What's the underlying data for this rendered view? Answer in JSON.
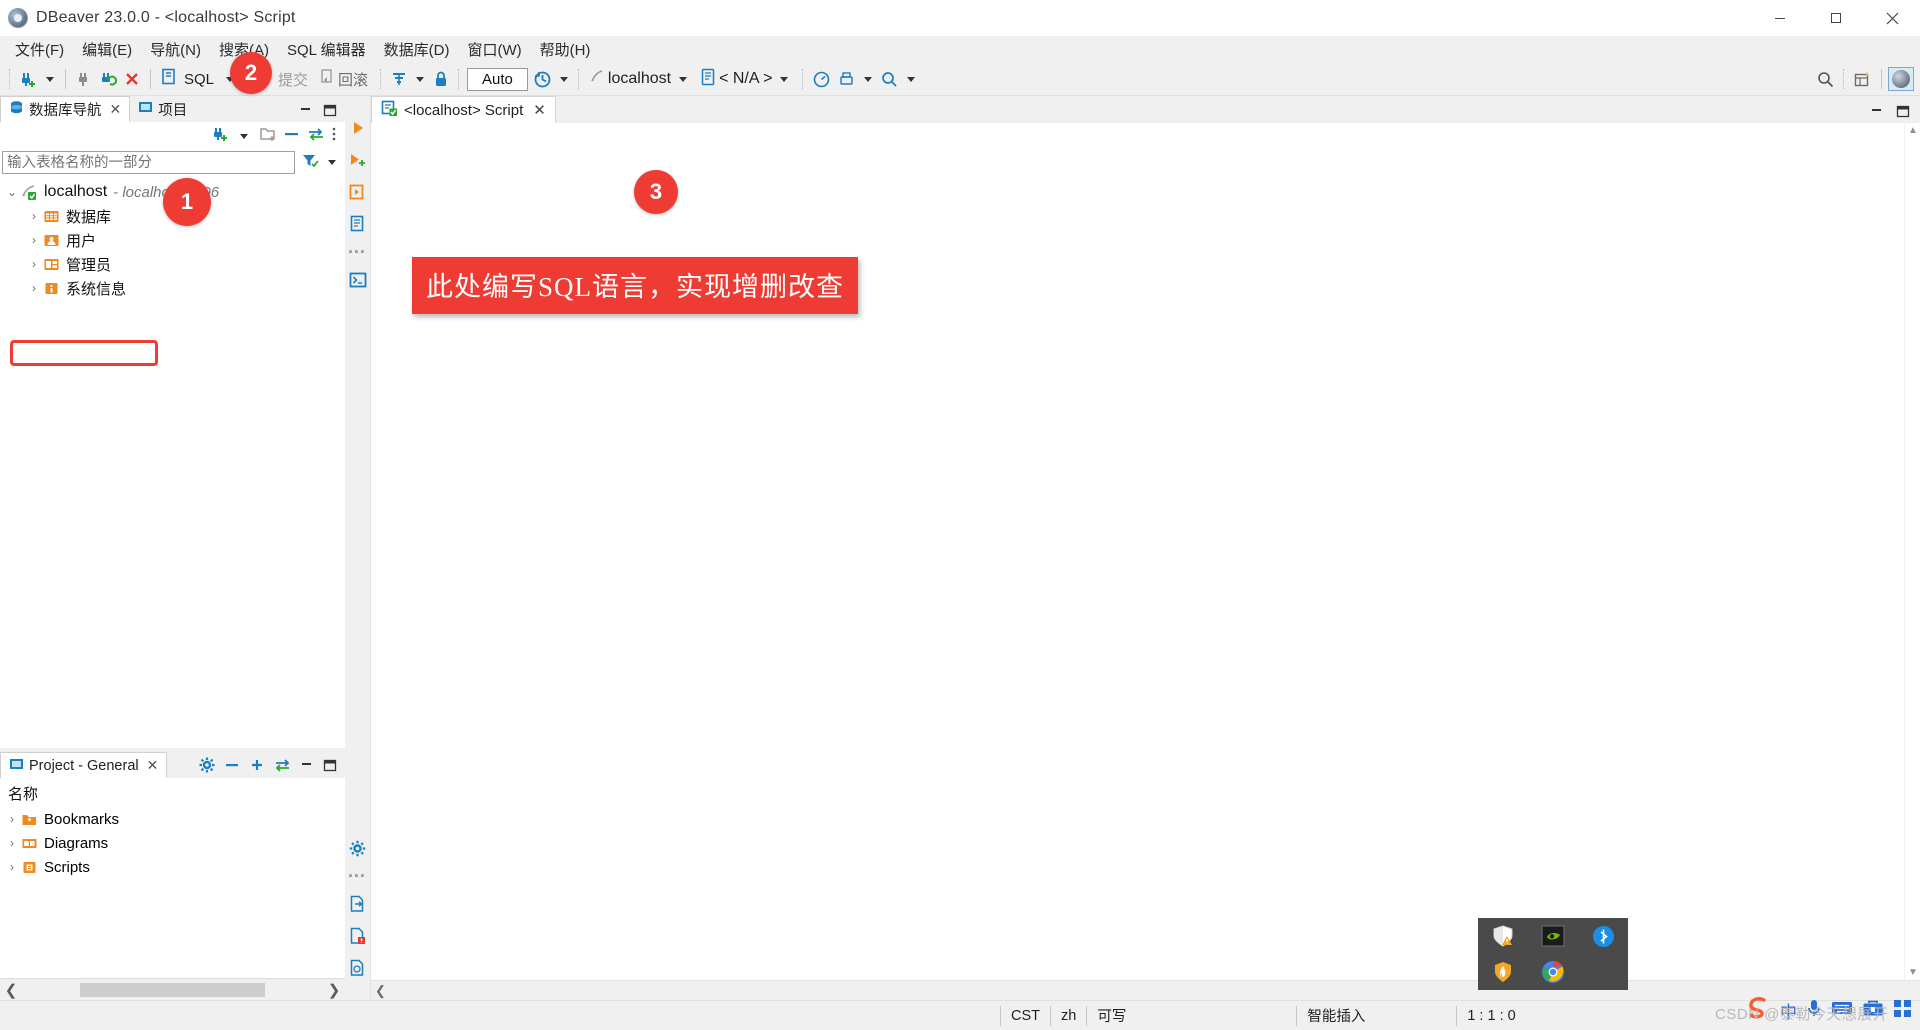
{
  "window": {
    "title": "DBeaver 23.0.0 - <localhost> Script",
    "app_icon": "dbeaver-logo-icon",
    "minimize": "minimize-icon",
    "maximize": "maximize-icon",
    "close": "close-icon"
  },
  "menubar": {
    "items": [
      {
        "label": "文件(F)",
        "name": "menu-file"
      },
      {
        "label": "编辑(E)",
        "name": "menu-edit"
      },
      {
        "label": "导航(N)",
        "name": "menu-navigate"
      },
      {
        "label": "搜索(A)",
        "name": "menu-search"
      },
      {
        "label": "SQL 编辑器",
        "name": "menu-sql-editor"
      },
      {
        "label": "数据库(D)",
        "name": "menu-database"
      },
      {
        "label": "窗口(W)",
        "name": "menu-window"
      },
      {
        "label": "帮助(H)",
        "name": "menu-help"
      }
    ]
  },
  "toolbar": {
    "new_connection": "new-connection-icon",
    "new_connection_dropdown": "chevron-down-icon",
    "disconnect": "disconnect-icon",
    "refresh_connection": "refresh-connection-icon",
    "terminate": "terminate-icon",
    "sql_editor_label": "SQL",
    "sql_editor_icon": "sql-editor-icon",
    "sql_editor_dropdown": "chevron-down-icon",
    "commit_label": "提交",
    "rollback_label": "回滚",
    "commit_icon": "commit-icon",
    "rollback_icon": "rollback-icon",
    "txn_mode_icon": "transaction-mode-icon",
    "txn_mode_dropdown": "chevron-down-icon",
    "lock_icon": "lock-icon",
    "auto_label": "Auto",
    "history_icon": "history-icon",
    "history_dropdown": "chevron-down-icon",
    "datasource_icon": "datasource-icon",
    "datasource_label": "localhost",
    "datasource_dropdown": "chevron-down-icon",
    "schema_icon": "schema-icon",
    "schema_label": "< N/A >",
    "schema_dropdown": "chevron-down-icon",
    "dashboard_icon": "dashboard-icon",
    "print_icon": "print-icon",
    "print_dropdown": "chevron-down-icon",
    "zoom_icon": "search-icon",
    "zoom_dropdown": "chevron-down-icon",
    "right_search_icon": "search-icon",
    "right_perspective_icon": "open-perspective-icon",
    "right_avatar": "user-avatar"
  },
  "navigator": {
    "tabs": [
      {
        "label": "数据库导航",
        "name": "tab-database-navigator",
        "icon": "database-navigator-icon",
        "active": true,
        "closable": true
      },
      {
        "label": "项目",
        "name": "tab-projects",
        "icon": "projects-icon",
        "active": false,
        "closable": false
      }
    ],
    "minimize_icon": "minimize-panel-icon",
    "maximize_icon": "maximize-panel-icon",
    "toolbar": {
      "new_connection_icon": "new-connection-icon",
      "new_connection_dropdown": "chevron-down-icon",
      "new_folder_icon": "new-folder-icon",
      "collapse_all_icon": "collapse-all-icon",
      "link_editor_icon": "link-with-editor-icon",
      "view_menu_icon": "view-menu-icon"
    },
    "filter": {
      "placeholder": "输入表格名称的一部分",
      "value": "",
      "filter_icon": "filter-icon",
      "filter_dropdown": "chevron-down-icon"
    },
    "tree": [
      {
        "label": "localhost",
        "sublabel": "- localhost:3306",
        "icon": "connection-icon",
        "expanded": true,
        "depth": 0,
        "name": "tree-node-localhost"
      },
      {
        "label": "数据库",
        "sublabel": "",
        "icon": "databases-folder-icon",
        "expanded": false,
        "depth": 1,
        "name": "tree-node-databases"
      },
      {
        "label": "用户",
        "sublabel": "",
        "icon": "users-folder-icon",
        "expanded": false,
        "depth": 1,
        "name": "tree-node-users"
      },
      {
        "label": "管理员",
        "sublabel": "",
        "icon": "admin-folder-icon",
        "expanded": false,
        "depth": 1,
        "name": "tree-node-administrators"
      },
      {
        "label": "系统信息",
        "sublabel": "",
        "icon": "system-info-folder-icon",
        "expanded": false,
        "depth": 1,
        "name": "tree-node-system-info"
      }
    ]
  },
  "project_panel": {
    "tab_label": "Project - General",
    "tab_icon": "project-icon",
    "close_icon": "close-icon",
    "controls": {
      "settings_icon": "gear-icon",
      "minimize_icon": "collapse-icon",
      "add_icon": "add-icon",
      "link_icon": "link-with-editor-icon",
      "minimize_panel_icon": "minimize-panel-icon",
      "maximize_panel_icon": "maximize-panel-icon"
    },
    "column_header": "名称",
    "items": [
      {
        "label": "Bookmarks",
        "icon": "bookmarks-folder-icon",
        "name": "project-item-bookmarks"
      },
      {
        "label": "Diagrams",
        "icon": "diagrams-folder-icon",
        "name": "project-item-diagrams"
      },
      {
        "label": "Scripts",
        "icon": "scripts-folder-icon",
        "name": "project-item-scripts"
      }
    ],
    "hscroll": {
      "left_arrow": "chevron-left-icon",
      "right_arrow": "chevron-right-icon"
    }
  },
  "editor": {
    "vertical_toolbar": [
      {
        "icon": "execute-statement-icon",
        "name": "vtb-execute-sql-statement"
      },
      {
        "icon": "execute-script-icon",
        "name": "vtb-execute-sql-script"
      },
      {
        "icon": "execute-new-tab-icon",
        "name": "vtb-execute-in-new-tab"
      },
      {
        "icon": "execute-script-report-icon",
        "name": "vtb-generate-script-report"
      },
      {
        "icon": "sql-console-icon",
        "name": "vtb-sql-console"
      }
    ],
    "vertical_toolbar_bottom": [
      {
        "icon": "gear-icon",
        "name": "vtb-editor-settings"
      },
      {
        "icon": "export-resultset-icon",
        "name": "vtb-export-from-query"
      },
      {
        "icon": "script-error-icon",
        "name": "vtb-script-error"
      },
      {
        "icon": "sql-terminal-icon",
        "name": "vtb-sql-terminal"
      }
    ],
    "tabs": [
      {
        "label": "<localhost> Script",
        "icon": "sql-script-icon",
        "name": "editor-tab-localhost-script",
        "active": true
      }
    ],
    "tab_minimize_icon": "minimize-panel-icon",
    "tab_maximize_icon": "maximize-panel-icon",
    "content": "",
    "scroll_up_icon": "chevron-up-icon",
    "scroll_down_icon": "chevron-down-icon",
    "hscroll_left_icon": "chevron-left-icon"
  },
  "annotations": {
    "badge1": "1",
    "badge2": "2",
    "badge3": "3",
    "callout_text": "此处编写SQL语言，实现增删改查",
    "accent_color": "#ee3b33"
  },
  "statusbar": {
    "timezone": "CST",
    "language": "zh",
    "writable": "可写",
    "insert_mode": "智能插入",
    "position": "1 : 1 : 0"
  },
  "tray": {
    "icons": [
      {
        "icon": "windows-defender-warning-icon",
        "name": "tray-defender"
      },
      {
        "icon": "nvidia-icon",
        "name": "tray-nvidia"
      },
      {
        "icon": "bluetooth-icon",
        "name": "tray-bluetooth"
      },
      {
        "icon": "shield-flame-icon",
        "name": "tray-security"
      },
      {
        "icon": "chrome-icon",
        "name": "tray-chrome"
      }
    ]
  },
  "ime": {
    "logo": "sogou-logo-icon",
    "mode": "中",
    "voice_icon": "microphone-icon",
    "keyboard_icon": "keyboard-icon",
    "tools_icon": "toolbox-icon",
    "apps_icon": "apps-icon"
  },
  "watermark": "CSDN @泰勒今天想展开"
}
